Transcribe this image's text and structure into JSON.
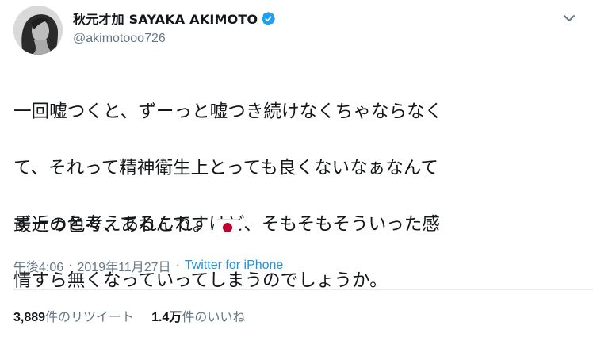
{
  "user": {
    "display_name": "秋元才加 SAYAKA AKIMOTO",
    "handle": "@akimotooo726",
    "verified": true
  },
  "icons": {
    "verified": "verified-badge-icon",
    "caret": "chevron-down-icon",
    "flag": "japan-flag-emoji"
  },
  "tweet": {
    "lines": [
      "一回嘘つくと、ずーっと嘘つき続けなくちゃならなく",
      "て、それって精神衛生上とっても良くないなぁなんて",
      "ずーっと考えてるんですけど、そもそもそういった感",
      "情すら無くなっていってしまうのでしょうか。"
    ],
    "closing": "最近の色々、あれこれ。"
  },
  "meta": {
    "time": "午後4:06",
    "separator": "·",
    "date": "2019年11月27日",
    "source": "Twitter for iPhone"
  },
  "stats": {
    "retweets_count": "3,889",
    "retweets_label": "件のリツイート",
    "likes_count": "1.4万",
    "likes_label": "件のいいね"
  },
  "colors": {
    "text": "#14171a",
    "secondary": "#657786",
    "link": "#1b95e0",
    "verified": "#1da1f2",
    "divider": "#e6ecf0",
    "flag_red": "#bc002d"
  }
}
